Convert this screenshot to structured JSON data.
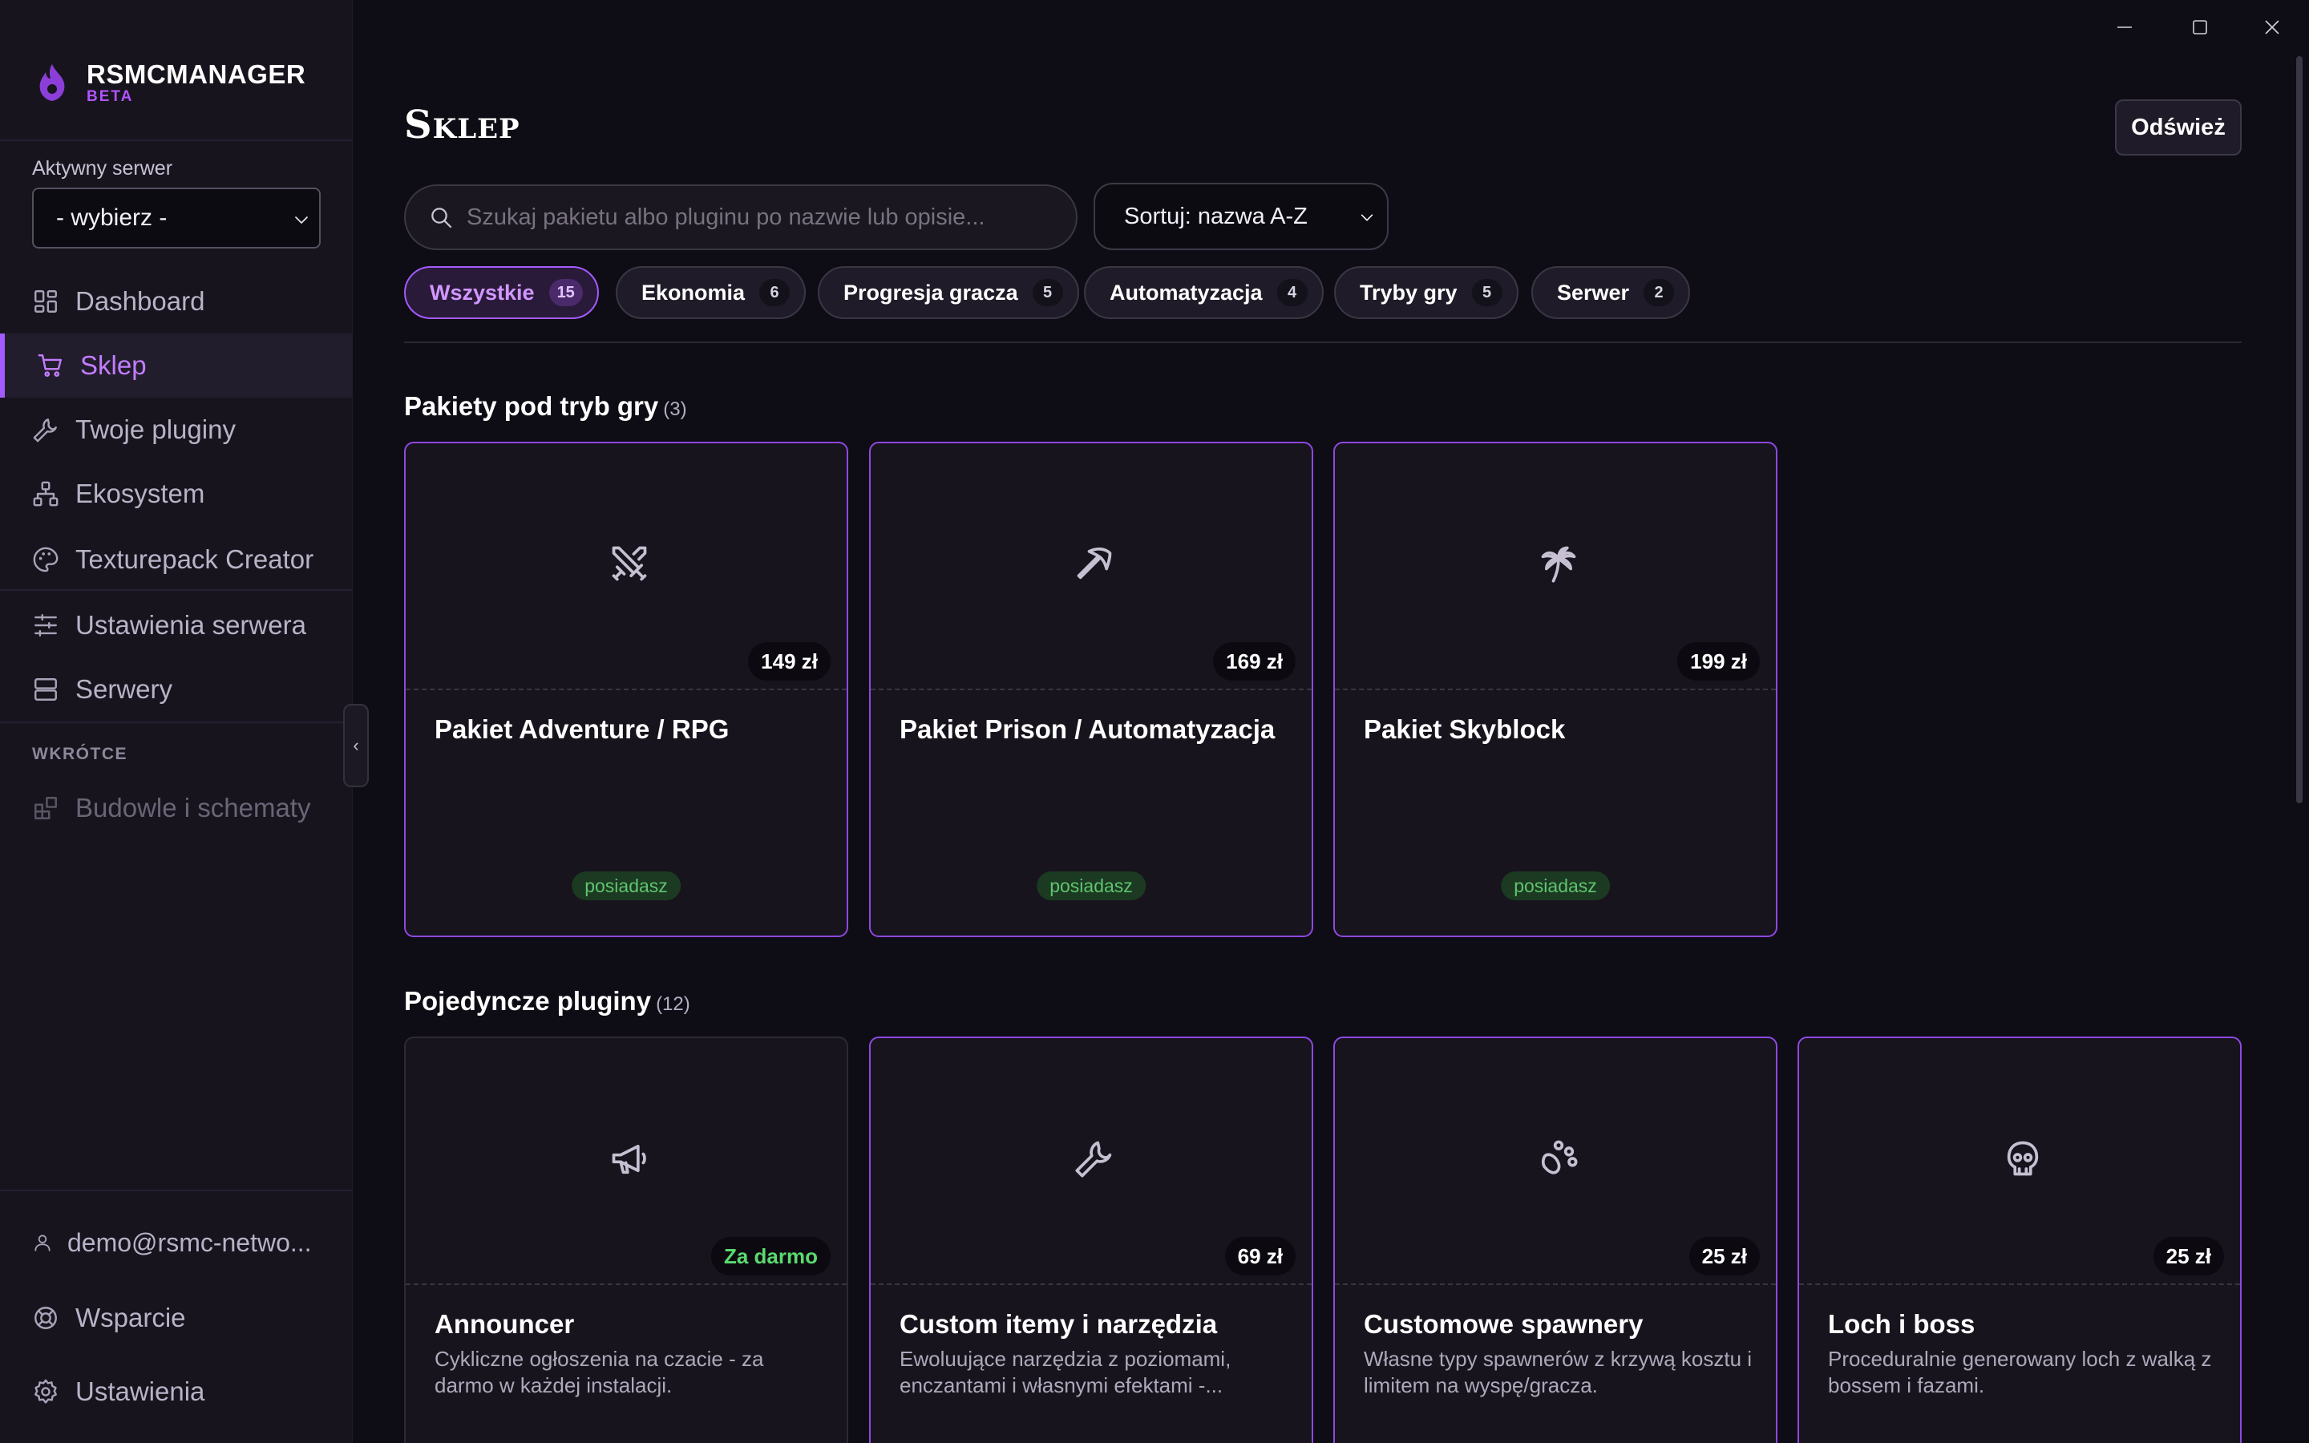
{
  "app": {
    "name": "RSMCMANAGER",
    "badge": "BETA"
  },
  "server": {
    "label": "Aktywny serwer",
    "selected": "- wybierz -"
  },
  "nav": [
    {
      "label": "Dashboard",
      "icon": "dashboard-icon"
    },
    {
      "label": "Sklep",
      "icon": "cart-icon",
      "active": true
    },
    {
      "label": "Twoje pluginy",
      "icon": "wrench-icon"
    },
    {
      "label": "Ekosystem",
      "icon": "network-icon"
    },
    {
      "label": "Texturepack Creator",
      "icon": "palette-icon"
    },
    {
      "label": "Ustawienia serwera",
      "icon": "sliders-icon"
    },
    {
      "label": "Serwery",
      "icon": "server-icon"
    }
  ],
  "soon": {
    "label": "WKRÓTCE",
    "items": [
      {
        "label": "Budowle i schematy",
        "icon": "blocks-icon"
      }
    ]
  },
  "footer": {
    "user": "demo@rsmc-netwo...",
    "support": "Wsparcie",
    "settings": "Ustawienia"
  },
  "page": {
    "title": "Sklep",
    "refresh": "Odśwież"
  },
  "search": {
    "placeholder": "Szukaj pakietu albo pluginu po nazwie lub opisie..."
  },
  "sort": {
    "selected": "Sortuj: nazwa A-Z"
  },
  "filters": [
    {
      "label": "Wszystkie",
      "count": "15",
      "active": true
    },
    {
      "label": "Ekonomia",
      "count": "6"
    },
    {
      "label": "Progresja gracza",
      "count": "5"
    },
    {
      "label": "Automatyzacja",
      "count": "4"
    },
    {
      "label": "Tryby gry",
      "count": "5"
    },
    {
      "label": "Serwer",
      "count": "2"
    }
  ],
  "packs": {
    "title": "Pakiety pod tryb gry",
    "count": "(3)",
    "items": [
      {
        "title": "Pakiet Adventure / RPG",
        "price": "149 zł",
        "status": "posiadasz",
        "icon": "swords-icon"
      },
      {
        "title": "Pakiet Prison / Automatyzacja",
        "price": "169 zł",
        "status": "posiadasz",
        "icon": "pickaxe-icon"
      },
      {
        "title": "Pakiet Skyblock",
        "price": "199 zł",
        "status": "posiadasz",
        "icon": "palm-icon"
      }
    ]
  },
  "plugins": {
    "title": "Pojedyncze pluginy",
    "count": "(12)",
    "items": [
      {
        "title": "Announcer",
        "price": "Za darmo",
        "desc": "Cykliczne ogłoszenia na czacie - za darmo w każdej instalacji.",
        "icon": "megaphone-icon"
      },
      {
        "title": "Custom itemy i narzędzia",
        "price": "69 zł",
        "desc": "Ewoluujące narzędzia z poziomami, enczantami i własnymi efektami -...",
        "icon": "wrench-icon"
      },
      {
        "title": "Customowe spawnery",
        "price": "25 zł",
        "desc": "Własne typy spawnerów z krzywą kosztu i limitem na wyspę/gracza.",
        "icon": "paw-icon"
      },
      {
        "title": "Loch i boss",
        "price": "25 zł",
        "desc": "Proceduralnie generowany loch z walką z bossem i fazami.",
        "icon": "skull-icon"
      }
    ]
  },
  "colors": {
    "accent": "#a35bff",
    "background": "#0e0c14",
    "sidebar": "#17141e",
    "owned": "#5fc46f"
  }
}
